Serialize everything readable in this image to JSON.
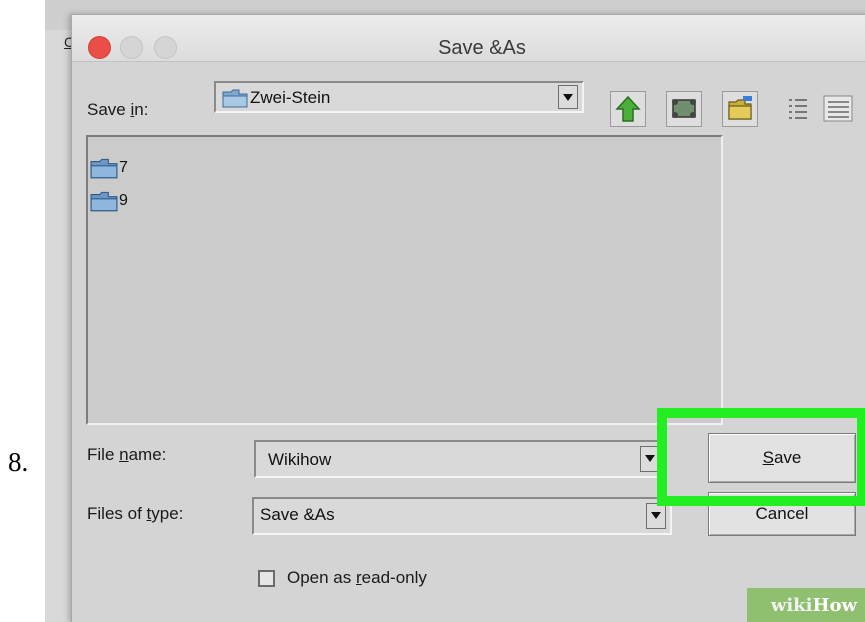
{
  "step_label": "8.",
  "background_app": {
    "partial_menu_text": "Ca"
  },
  "dialog": {
    "title": "Save &As",
    "save_in_label_pre": "Save ",
    "save_in_label_ul": "i",
    "save_in_label_post": "n:",
    "save_in_value": "Zwei-Stein",
    "toolbar_icons": [
      "up-folder-icon",
      "desktop-icon",
      "new-folder-icon",
      "list-view-icon",
      "details-view-icon"
    ],
    "files": [
      {
        "name": "7",
        "icon": "folder-icon"
      },
      {
        "name": "9",
        "icon": "folder-icon"
      }
    ],
    "file_name_label_pre": "File ",
    "file_name_label_ul": "n",
    "file_name_label_post": "ame:",
    "file_name_value": "Wikihow",
    "files_of_type_label_pre": "Files of ",
    "files_of_type_label_ul": "t",
    "files_of_type_label_post": "ype:",
    "files_of_type_value": "Save &As",
    "save_button_ul": "S",
    "save_button_post": "ave",
    "cancel_button": "Cancel",
    "read_only_pre": "Open as ",
    "read_only_ul": "r",
    "read_only_post": "ead-only",
    "read_only_checked": false
  },
  "watermark": {
    "part1": "wiki",
    "part2": "How"
  },
  "colors": {
    "highlight": "#22ee22",
    "close_button": "#ea4e47",
    "dialog_bg": "#d4d4d4",
    "watermark_bg": "#8fc06f"
  }
}
